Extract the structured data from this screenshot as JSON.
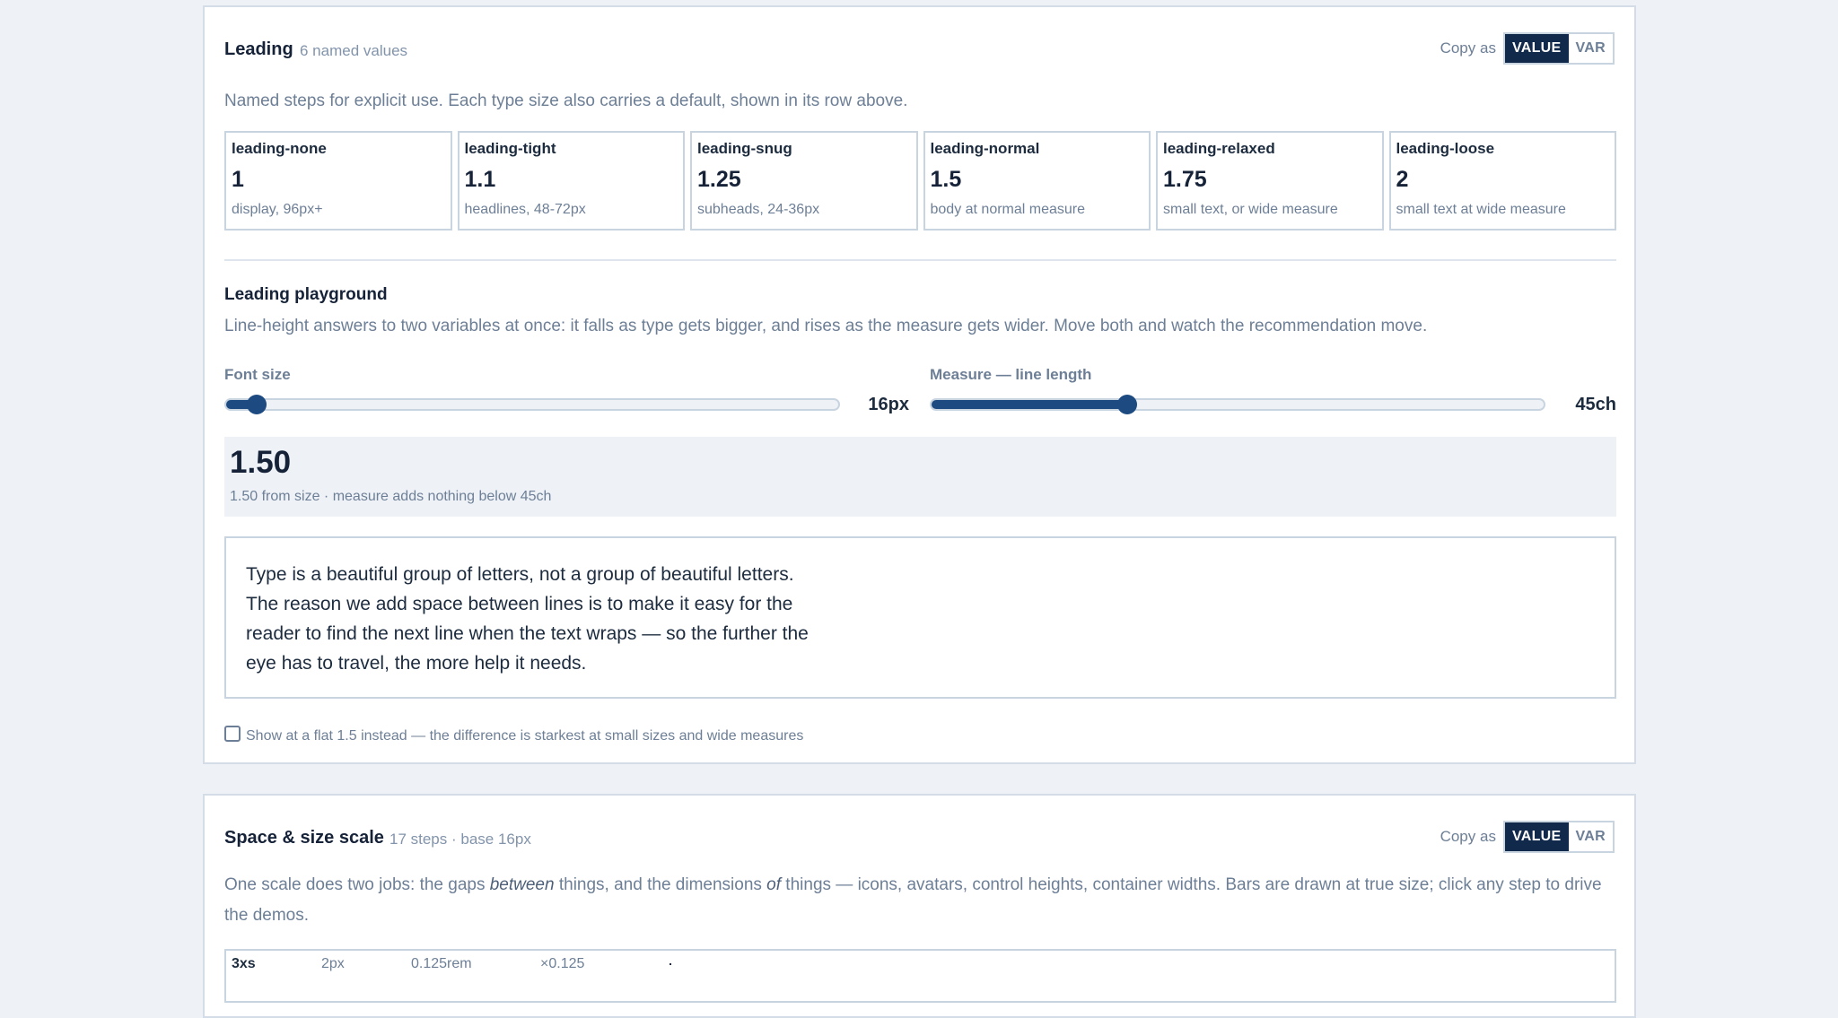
{
  "leading": {
    "title": "Leading",
    "meta": "6 named values",
    "copy_label": "Copy as",
    "copy_options": [
      "VALUE",
      "VAR"
    ],
    "description": "Named steps for explicit use. Each type size also carries a default, shown in its row above.",
    "steps": [
      {
        "name": "leading-none",
        "value": "1",
        "note": "display, 96px+"
      },
      {
        "name": "leading-tight",
        "value": "1.1",
        "note": "headlines, 48-72px"
      },
      {
        "name": "leading-snug",
        "value": "1.25",
        "note": "subheads, 24-36px"
      },
      {
        "name": "leading-normal",
        "value": "1.5",
        "note": "body at normal measure"
      },
      {
        "name": "leading-relaxed",
        "value": "1.75",
        "note": "small text, or wide measure"
      },
      {
        "name": "leading-loose",
        "value": "2",
        "note": "small text at wide measure"
      }
    ],
    "playground": {
      "title": "Leading playground",
      "description": "Line-height answers to two variables at once: it falls as type gets bigger, and rises as the measure gets wider. Move both and watch the recommendation move.",
      "font_size": {
        "label": "Font size",
        "value_label": "16px",
        "fraction": 0.05
      },
      "measure": {
        "label": "Measure — line length",
        "value_label": "45ch",
        "fraction": 0.32
      },
      "result_value": "1.50",
      "result_note": "1.50 from size · measure adds nothing below 45ch",
      "sample_text": "Type is a beautiful group of letters, not a group of beautiful letters. The reason we add space between lines is to make it easy for the reader to find the next line when the text wraps — so the further the eye has to travel, the more help it needs.",
      "flat_checkbox_label": "Show at a flat 1.5 instead — the difference is starkest at small sizes and wide measures",
      "flat_checked": false
    }
  },
  "space": {
    "title": "Space & size scale",
    "meta": "17 steps · base 16px",
    "copy_label": "Copy as",
    "copy_options": [
      "VALUE",
      "VAR"
    ],
    "description_parts": [
      "One scale does two jobs: the gaps ",
      "between",
      " things, and the dimensions ",
      "of",
      " things — icons, avatars, control heights, container widths. Bars are drawn at true size; click any step to drive the demos."
    ],
    "first_row": {
      "name": "3xs",
      "px": "2px",
      "rem": "0.125rem",
      "ratio": "×0.125"
    }
  },
  "colors": {
    "accent": "#1d4a80",
    "ink": "#152238",
    "muted": "#6d7f96",
    "border": "#c9d4e1",
    "bg": "#eef2f7"
  }
}
